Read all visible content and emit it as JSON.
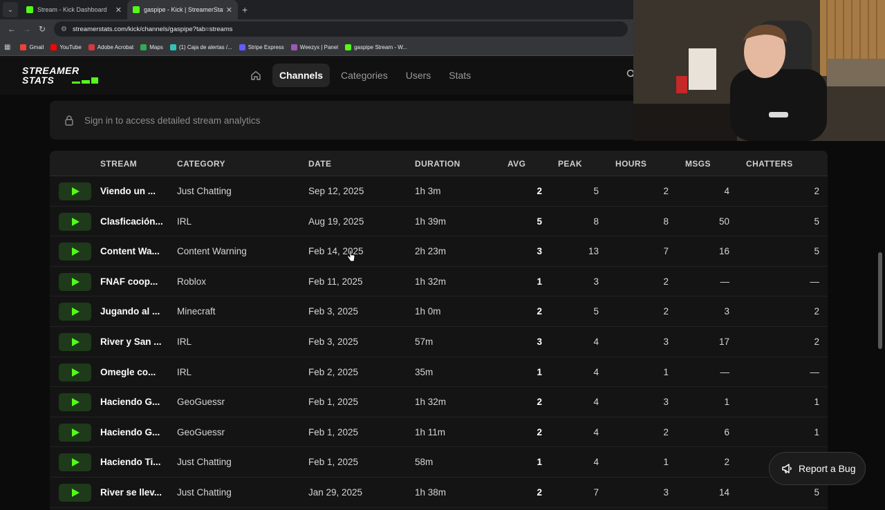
{
  "browser": {
    "tabs": [
      {
        "title": "Stream - Kick Dashboard",
        "favicon_color": "#53fc18",
        "active": false
      },
      {
        "title": "gaspipe - Kick | StreamerStats",
        "favicon_color": "#53fc18",
        "active": true
      }
    ],
    "url": "streamerstats.com/kick/channels/gaspipe?tab=streams",
    "bookmarks": [
      {
        "label": "Gmail",
        "color": "#ea4335"
      },
      {
        "label": "YouTube",
        "color": "#ff0000"
      },
      {
        "label": "Adobe Acrobat",
        "color": "#d7373f"
      },
      {
        "label": "Maps",
        "color": "#34a853"
      },
      {
        "label": "(1) Caja de alertas /...",
        "color": "#2ec4b6"
      },
      {
        "label": "Stripe Express",
        "color": "#635bff"
      },
      {
        "label": "Weezyx | Panel",
        "color": "#9b59b6"
      },
      {
        "label": "gaspipe Stream - W...",
        "color": "#53fc18"
      }
    ]
  },
  "site": {
    "logo_line1": "STREAMER",
    "logo_line2": "STATS",
    "nav": [
      "Channels",
      "Categories",
      "Users",
      "Stats"
    ],
    "active_nav": "Channels",
    "signin_text": "Sign in to access detailed stream analytics",
    "accent": "#53fc18"
  },
  "table": {
    "headers": {
      "stream": "STREAM",
      "category": "CATEGORY",
      "date": "DATE",
      "duration": "DURATION",
      "avg": "AVG",
      "peak": "PEAK",
      "hours": "HOURS",
      "msgs": "MSGS",
      "chatters": "CHATTERS"
    },
    "rows": [
      {
        "stream": "Viendo un ...",
        "category": "Just Chatting",
        "date": "Sep 12, 2025",
        "duration": "1h 3m",
        "avg": "2",
        "peak": "5",
        "hours": "2",
        "msgs": "4",
        "chatters": "2"
      },
      {
        "stream": "Clasficación...",
        "category": "IRL",
        "date": "Aug 19, 2025",
        "duration": "1h 39m",
        "avg": "5",
        "peak": "8",
        "hours": "8",
        "msgs": "50",
        "chatters": "5"
      },
      {
        "stream": "Content Wa...",
        "category": "Content Warning",
        "date": "Feb 14, 2025",
        "duration": "2h 23m",
        "avg": "3",
        "peak": "13",
        "hours": "7",
        "msgs": "16",
        "chatters": "5"
      },
      {
        "stream": "FNAF coop...",
        "category": "Roblox",
        "date": "Feb 11, 2025",
        "duration": "1h 32m",
        "avg": "1",
        "peak": "3",
        "hours": "2",
        "msgs": "—",
        "chatters": "—"
      },
      {
        "stream": "Jugando al ...",
        "category": "Minecraft",
        "date": "Feb 3, 2025",
        "duration": "1h 0m",
        "avg": "2",
        "peak": "5",
        "hours": "2",
        "msgs": "3",
        "chatters": "2"
      },
      {
        "stream": "River y San ...",
        "category": "IRL",
        "date": "Feb 3, 2025",
        "duration": "57m",
        "avg": "3",
        "peak": "4",
        "hours": "3",
        "msgs": "17",
        "chatters": "2"
      },
      {
        "stream": "Omegle co...",
        "category": "IRL",
        "date": "Feb 2, 2025",
        "duration": "35m",
        "avg": "1",
        "peak": "4",
        "hours": "1",
        "msgs": "—",
        "chatters": "—"
      },
      {
        "stream": "Haciendo G...",
        "category": "GeoGuessr",
        "date": "Feb 1, 2025",
        "duration": "1h 32m",
        "avg": "2",
        "peak": "4",
        "hours": "3",
        "msgs": "1",
        "chatters": "1"
      },
      {
        "stream": "Haciendo G...",
        "category": "GeoGuessr",
        "date": "Feb 1, 2025",
        "duration": "1h 11m",
        "avg": "2",
        "peak": "4",
        "hours": "2",
        "msgs": "6",
        "chatters": "1"
      },
      {
        "stream": "Haciendo Ti...",
        "category": "Just Chatting",
        "date": "Feb 1, 2025",
        "duration": "58m",
        "avg": "1",
        "peak": "4",
        "hours": "1",
        "msgs": "2",
        "chatters": ""
      },
      {
        "stream": "River se llev...",
        "category": "Just Chatting",
        "date": "Jan 29, 2025",
        "duration": "1h 38m",
        "avg": "2",
        "peak": "7",
        "hours": "3",
        "msgs": "14",
        "chatters": "5"
      }
    ]
  },
  "report_button": "Report a Bug"
}
